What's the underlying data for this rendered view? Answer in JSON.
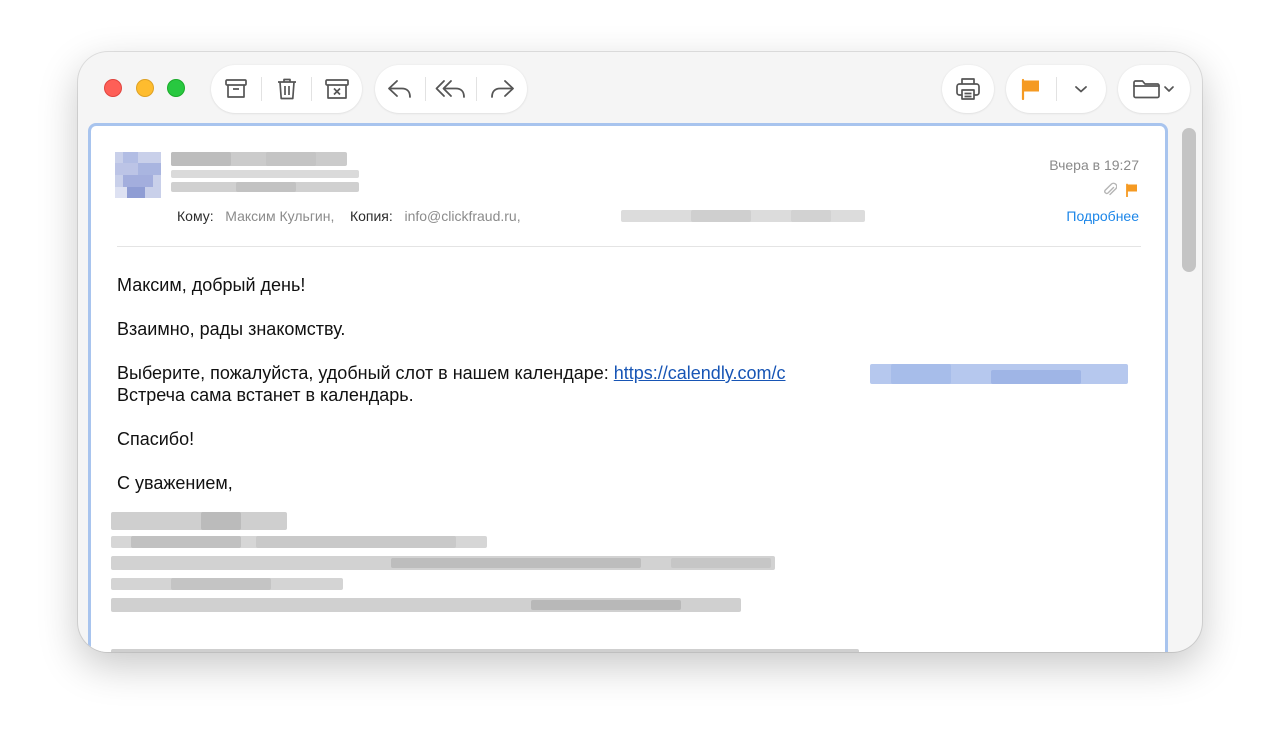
{
  "toolbar": {
    "archive": "archive-icon",
    "delete": "trash-icon",
    "junk": "junk-icon",
    "reply": "reply-icon",
    "reply_all": "reply-all-icon",
    "forward": "forward-icon",
    "print": "print-icon",
    "flag": "flag-icon",
    "flag_menu": "chevron-down-icon",
    "move": "folder-icon",
    "flag_color": "#f59a22"
  },
  "header": {
    "date": "Вчера в 19:27",
    "to_label": "Кому:",
    "to_value": "Максим Кульгин,",
    "cc_label": "Копия:",
    "cc_value": "info@clickfraud.ru,",
    "details_link": "Подробнее"
  },
  "body": {
    "greeting": "Максим, добрый день!",
    "line1": "Взаимно, рады знакомству.",
    "line2_text": "Выберите, пожалуйста, удобный слот в нашем календаре: ",
    "line2_link": "https://calendly.com/c",
    "line3": "Встреча сама встанет в календарь.",
    "thanks": "Спасибо!",
    "closing": "С уважением,"
  }
}
